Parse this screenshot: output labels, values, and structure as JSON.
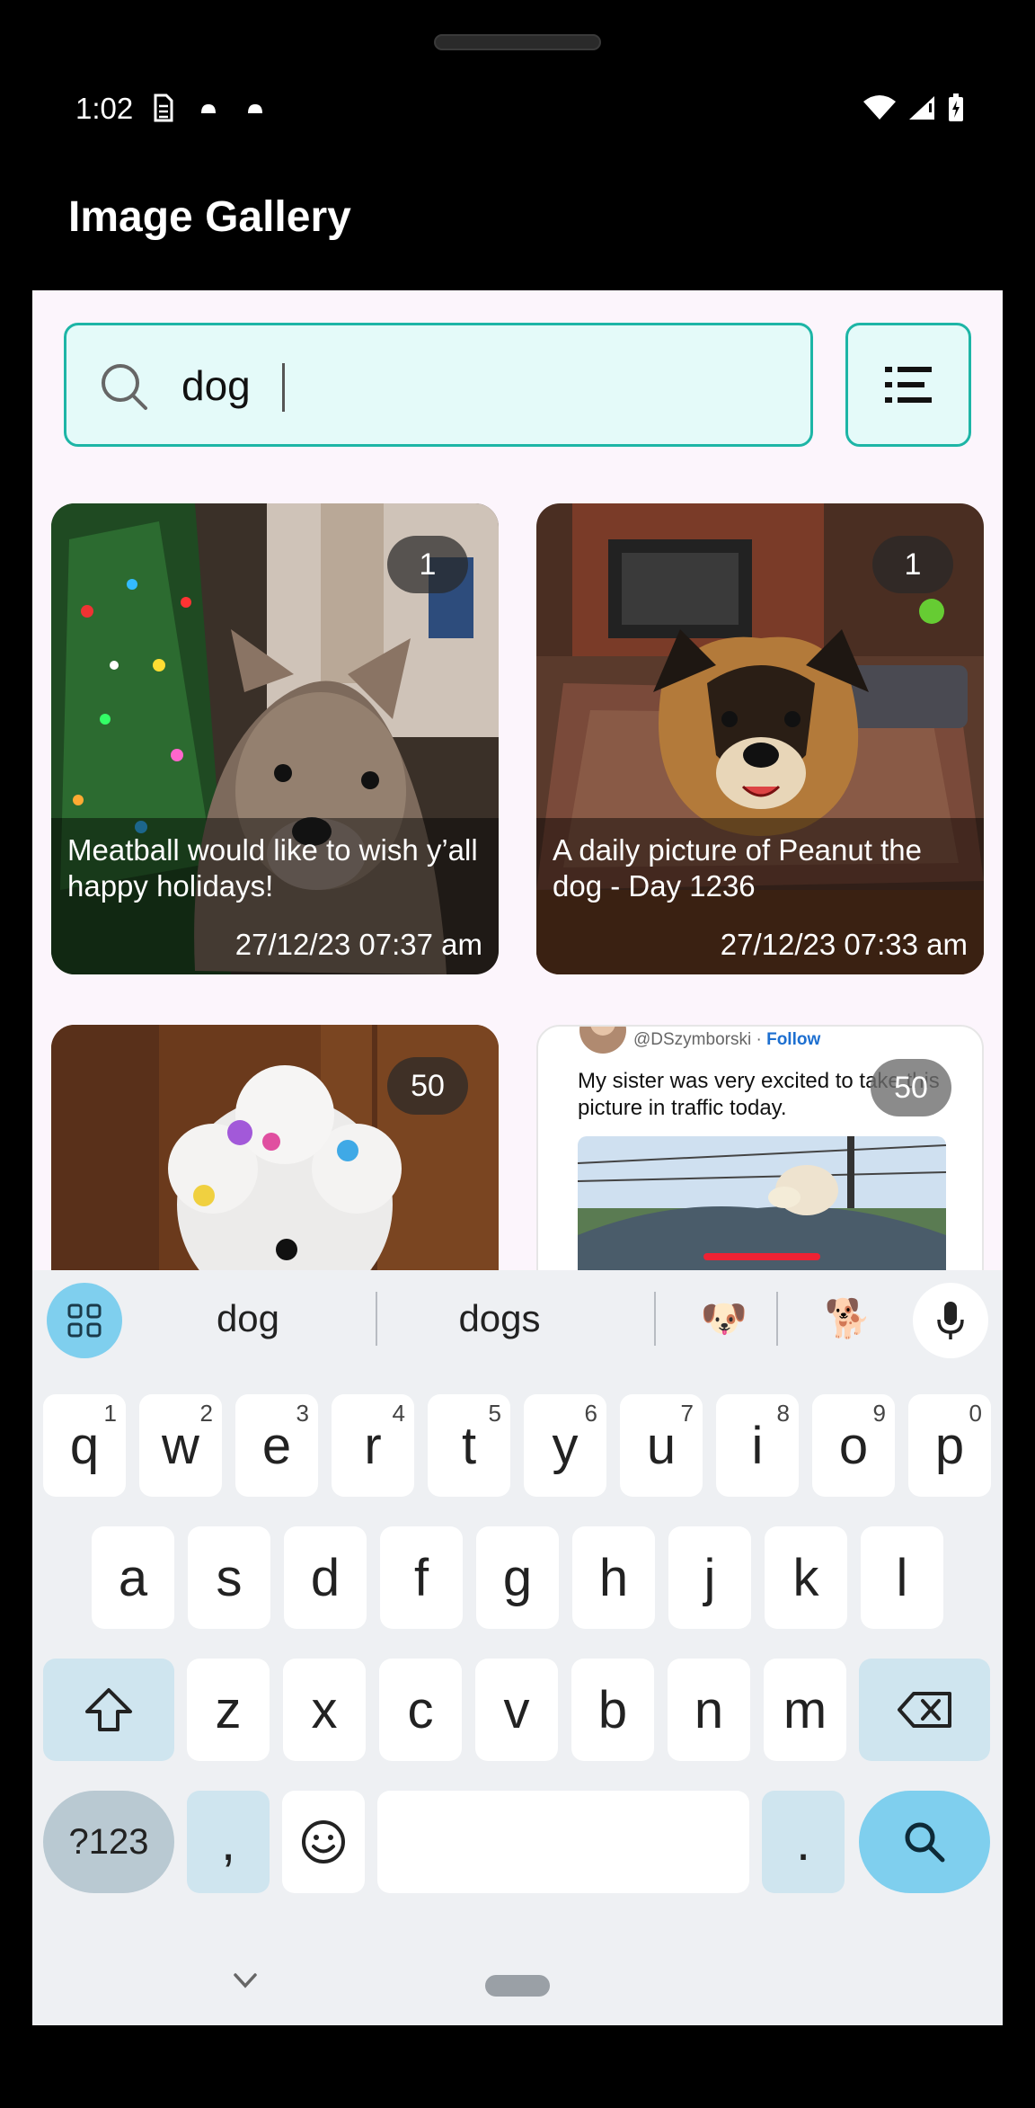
{
  "status_bar": {
    "time": "1:02"
  },
  "app_bar": {
    "title": "Image Gallery"
  },
  "search": {
    "value": "dog",
    "placeholder": ""
  },
  "cards": [
    {
      "count": "1",
      "caption": "Meatball would like to wish y’all happy holidays!",
      "date": "27/12/23 07:37 am"
    },
    {
      "count": "1",
      "caption": "A daily picture of Peanut the dog - Day 1236",
      "date": "27/12/23 07:33 am"
    },
    {
      "count": "50"
    },
    {
      "count": "50",
      "tweet_handle": "@DSzymborski",
      "tweet_follow": "Follow",
      "tweet_text": "My sister was very excited to take this picture in traffic today."
    }
  ],
  "keyboard": {
    "suggestions": [
      "dog",
      "dogs",
      "🐶",
      "🐕"
    ],
    "row1": [
      {
        "k": "q",
        "n": "1"
      },
      {
        "k": "w",
        "n": "2"
      },
      {
        "k": "e",
        "n": "3"
      },
      {
        "k": "r",
        "n": "4"
      },
      {
        "k": "t",
        "n": "5"
      },
      {
        "k": "y",
        "n": "6"
      },
      {
        "k": "u",
        "n": "7"
      },
      {
        "k": "i",
        "n": "8"
      },
      {
        "k": "o",
        "n": "9"
      },
      {
        "k": "p",
        "n": "0"
      }
    ],
    "row2": [
      "a",
      "s",
      "d",
      "f",
      "g",
      "h",
      "j",
      "k",
      "l"
    ],
    "row3": [
      "z",
      "x",
      "c",
      "v",
      "b",
      "n",
      "m"
    ],
    "symbols_label": "?123",
    "comma_label": ",",
    "period_label": "."
  },
  "colors": {
    "accent": "#1db5a6",
    "search_bg": "#e4faf9",
    "screen_bg": "#fcf5fc",
    "action_key": "#7fcfee"
  }
}
